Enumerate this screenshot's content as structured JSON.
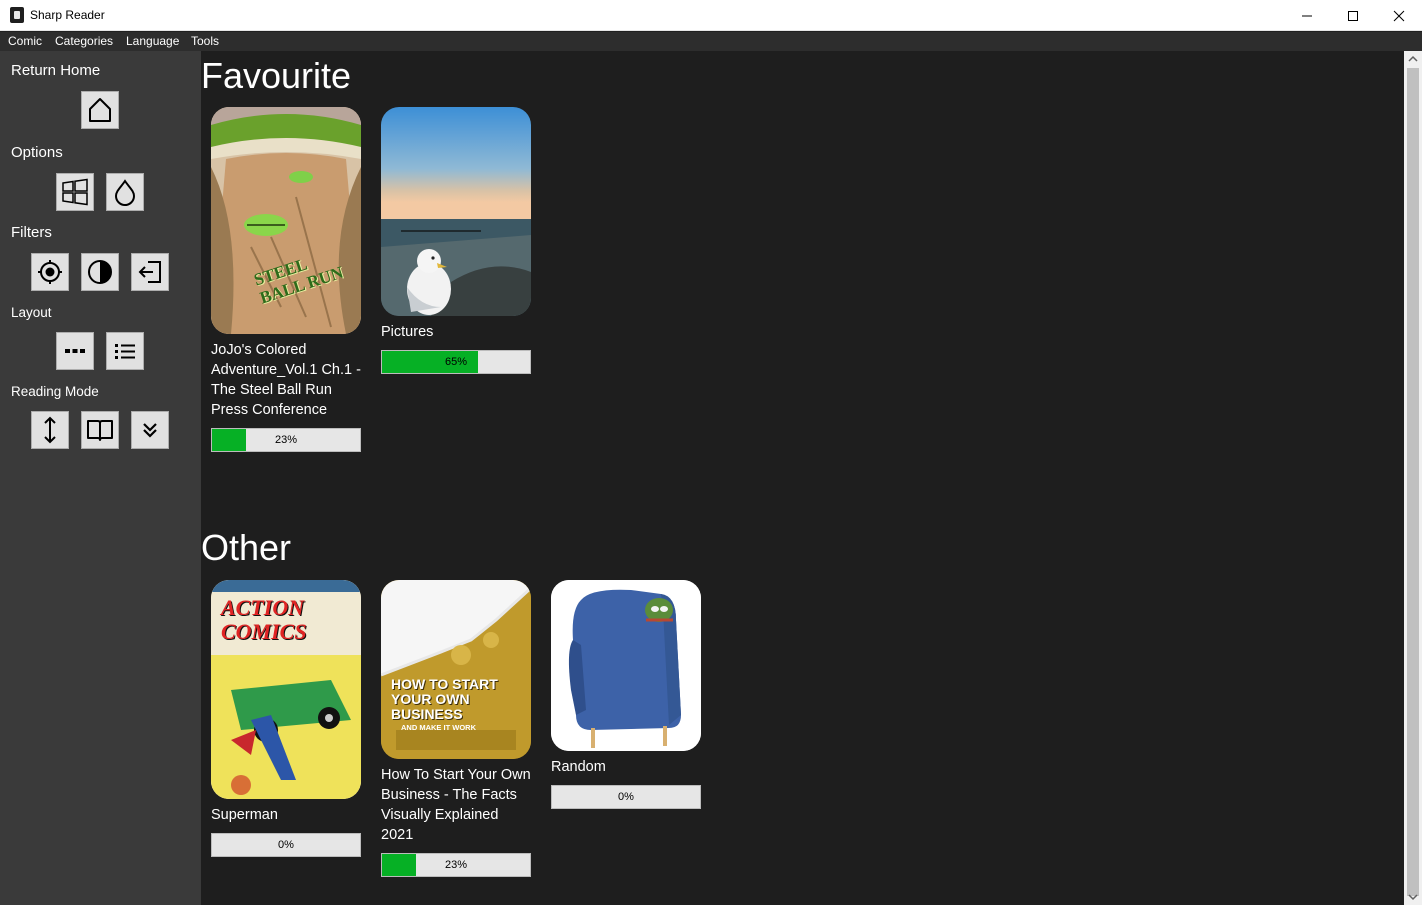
{
  "window": {
    "title": "Sharp Reader",
    "controls": [
      "minimize-icon",
      "maximize-icon",
      "close-icon"
    ]
  },
  "menu": {
    "items": [
      "Comic",
      "Categories",
      "Language",
      "Tools"
    ]
  },
  "sidebar": {
    "return_home": {
      "label": "Return Home",
      "buttons": [
        "home-icon"
      ]
    },
    "options": {
      "label": "Options",
      "buttons": [
        "windows-icon",
        "drop-icon"
      ]
    },
    "filters": {
      "label": "Filters",
      "buttons": [
        "brightness-icon",
        "contrast-icon",
        "exit-icon"
      ]
    },
    "layout": {
      "label": "Layout",
      "buttons": [
        "dots-icon",
        "list-icon"
      ]
    },
    "reading_mode": {
      "label": "Reading Mode",
      "buttons": [
        "vertical-scroll-icon",
        "book-icon",
        "double-chevron-down-icon"
      ]
    }
  },
  "favourite": {
    "title": "Favourite",
    "items": [
      {
        "title": "JoJo's Colored Adventure_Vol.1 Ch.1 - The Steel Ball Run Press Conference",
        "progress_text": "23%",
        "progress": 0.23,
        "cover_text": "STEEL BALL RUN"
      },
      {
        "title": "Pictures",
        "progress_text": "65%",
        "progress": 0.65
      }
    ]
  },
  "other": {
    "title": "Other",
    "items": [
      {
        "title": "Superman",
        "progress_text": "0%",
        "progress": 0,
        "cover_text": "ACTION COMICS"
      },
      {
        "title": "How To Start Your Own Business - The Facts Visually Explained 2021",
        "progress_text": "23%",
        "progress": 0.23,
        "cover_text": "HOW TO START YOUR OWN BUSINESS",
        "cover_subtext": "AND MAKE IT WORK"
      },
      {
        "title": "Random",
        "progress_text": "0%",
        "progress": 0
      }
    ]
  },
  "colors": {
    "progress_fill": "#06b025",
    "background": "#1e1e1e",
    "sidebar": "#3a3a3a"
  }
}
